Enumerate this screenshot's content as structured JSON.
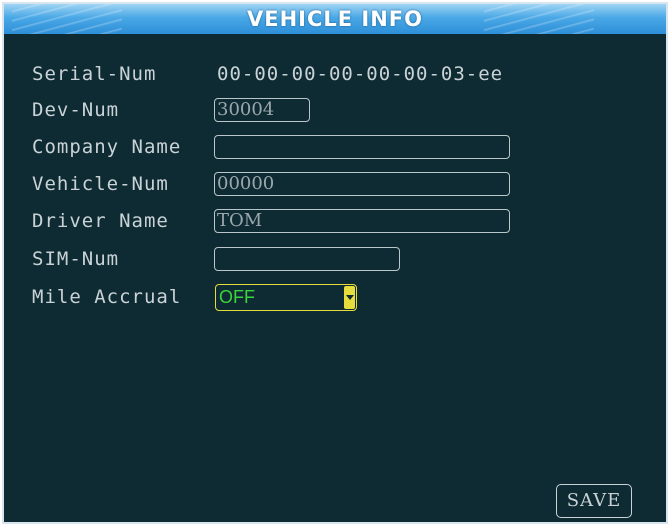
{
  "window": {
    "title": "VEHICLE INFO"
  },
  "fields": {
    "serial_num": {
      "label": "Serial-Num",
      "value": "00-00-00-00-00-00-03-ee"
    },
    "dev_num": {
      "label": "Dev-Num",
      "value": "30004"
    },
    "company_name": {
      "label": "Company Name",
      "value": ""
    },
    "vehicle_num": {
      "label": "Vehicle-Num",
      "value": "00000"
    },
    "driver_name": {
      "label": "Driver Name",
      "value": "TOM"
    },
    "sim_num": {
      "label": "SIM-Num",
      "value": ""
    },
    "mile_accrual": {
      "label": "Mile Accrual",
      "value": "OFF"
    }
  },
  "buttons": {
    "save": "SAVE"
  },
  "colors": {
    "background": "#0e2a33",
    "title_bar": "#2d8fd8",
    "focus_border": "#e6dc3c",
    "selected_value": "#3bd43b"
  }
}
